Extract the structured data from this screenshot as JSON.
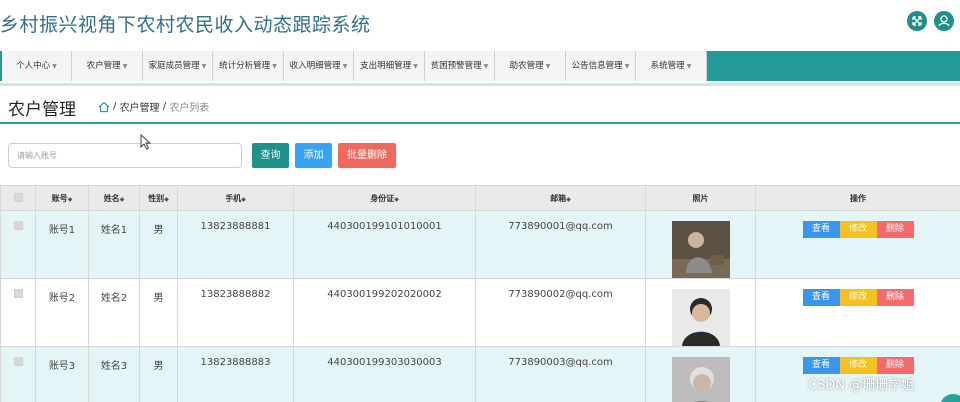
{
  "app": {
    "title": "乡村振兴视角下农村农民收入动态跟踪系统"
  },
  "top_icons": [
    "expand-icon",
    "user-icon"
  ],
  "nav": {
    "items": [
      {
        "label": "个人中心"
      },
      {
        "label": "农户管理"
      },
      {
        "label": "家庭成员管理"
      },
      {
        "label": "统计分析管理"
      },
      {
        "label": "收入明细管理"
      },
      {
        "label": "支出明细管理"
      },
      {
        "label": "贫困预警管理"
      },
      {
        "label": "助农管理"
      },
      {
        "label": "公告信息管理"
      },
      {
        "label": "系统管理"
      }
    ]
  },
  "page": {
    "title": "农户管理",
    "breadcrumb": {
      "sep": "/",
      "parent": "农户管理",
      "current": "农户列表"
    }
  },
  "search": {
    "placeholder": "请输入账号",
    "value": ""
  },
  "toolbar": {
    "query": "查询",
    "add": "添加",
    "batch_delete": "批量删除"
  },
  "table": {
    "headers": [
      "账号",
      "姓名",
      "性别",
      "手机",
      "身份证",
      "邮箱",
      "照片",
      "操作"
    ],
    "rows": [
      {
        "account": "账号1",
        "name": "姓名1",
        "gender": "男",
        "phone": "13823888881",
        "id_card": "440300199101010001",
        "email": "773890001@qq.com"
      },
      {
        "account": "账号2",
        "name": "姓名2",
        "gender": "男",
        "phone": "13823888882",
        "id_card": "440300199202020002",
        "email": "773890002@qq.com"
      },
      {
        "account": "账号3",
        "name": "姓名3",
        "gender": "男",
        "phone": "13823888883",
        "id_card": "440300199303030003",
        "email": "773890003@qq.com"
      }
    ],
    "actions": {
      "view": "查看",
      "edit": "修改",
      "delete": "删除"
    }
  },
  "watermark": "CSDN @珊珊学姐",
  "colors": {
    "accent": "#24999a",
    "query": "#1e9288",
    "add": "#39a3f3",
    "danger": "#f0695f",
    "edit": "#f5c122",
    "view": "#3a96ec"
  }
}
